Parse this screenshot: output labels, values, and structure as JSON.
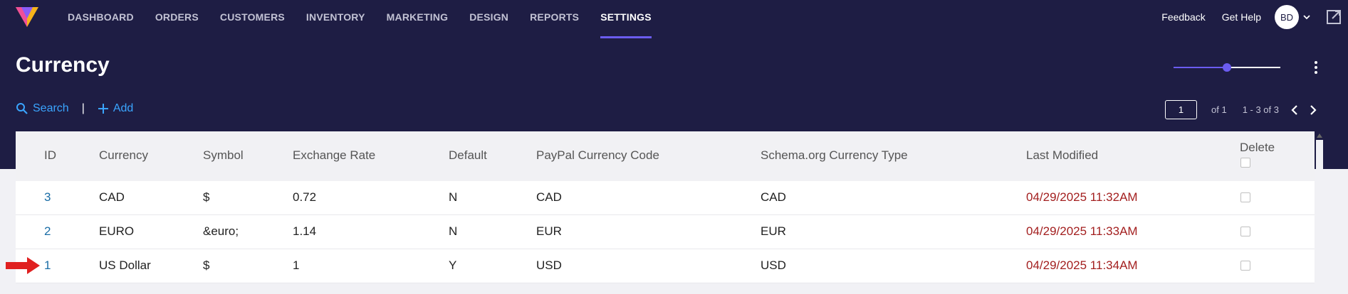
{
  "nav": {
    "items": [
      {
        "label": "DASHBOARD"
      },
      {
        "label": "ORDERS"
      },
      {
        "label": "CUSTOMERS"
      },
      {
        "label": "INVENTORY"
      },
      {
        "label": "MARKETING"
      },
      {
        "label": "DESIGN"
      },
      {
        "label": "REPORTS"
      },
      {
        "label": "SETTINGS",
        "active": true
      }
    ],
    "feedback_label": "Feedback",
    "help_label": "Get Help",
    "avatar_initials": "BD"
  },
  "page": {
    "title": "Currency"
  },
  "toolbar": {
    "search_label": "Search",
    "separator": "|",
    "add_label": "Add"
  },
  "pager": {
    "current_page": "1",
    "of_text": "of 1",
    "range_text": "1 - 3 of 3"
  },
  "slider": {
    "value_fraction": 0.5
  },
  "table": {
    "headers": {
      "id": "ID",
      "currency": "Currency",
      "symbol": "Symbol",
      "rate": "Exchange Rate",
      "default": "Default",
      "paypal": "PayPal Currency Code",
      "schema": "Schema.org Currency Type",
      "modified": "Last Modified",
      "delete": "Delete"
    },
    "rows": [
      {
        "id": "3",
        "currency": "CAD",
        "symbol": "$",
        "rate": "0.72",
        "default": "N",
        "paypal": "CAD",
        "schema": "CAD",
        "modified": "04/29/2025 11:32AM"
      },
      {
        "id": "2",
        "currency": "EURO",
        "symbol": "&euro;",
        "rate": "1.14",
        "default": "N",
        "paypal": "EUR",
        "schema": "EUR",
        "modified": "04/29/2025 11:33AM"
      },
      {
        "id": "1",
        "currency": "US Dollar",
        "symbol": "$",
        "rate": "1",
        "default": "Y",
        "paypal": "USD",
        "schema": "USD",
        "modified": "04/29/2025 11:34AM"
      }
    ]
  },
  "colors": {
    "header_bg": "#1e1d44",
    "accent": "#6b5cf0",
    "link_blue": "#3aa5ff",
    "date_red": "#a31f1f",
    "annotation_arrow": "#e02020"
  },
  "icons": {
    "logo": "brand-logo",
    "search": "search-icon",
    "add": "plus-icon",
    "chevron": "chevron-down-icon",
    "external": "external-link-icon",
    "kebab": "more-vert-icon",
    "prev": "chevron-left-icon",
    "next": "chevron-right-icon"
  }
}
